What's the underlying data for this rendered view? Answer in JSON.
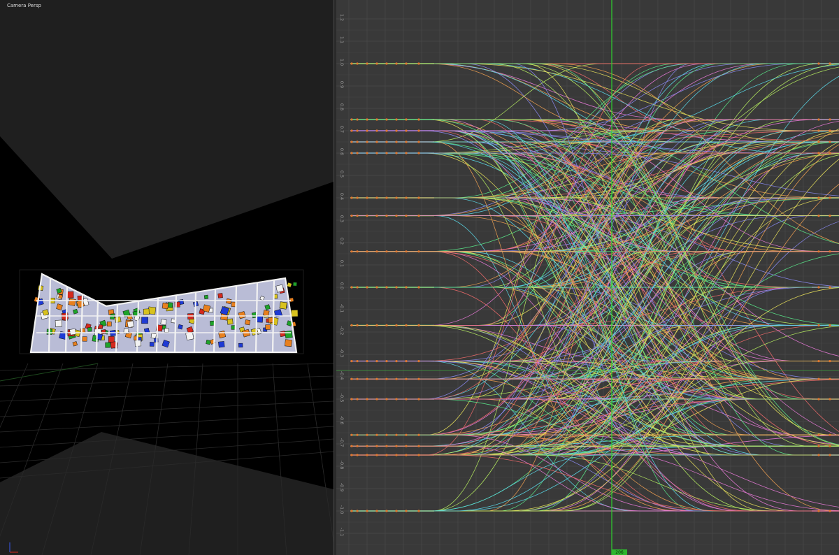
{
  "viewport": {
    "label": "Camera Persp",
    "colors": {
      "background": "#000000",
      "panel": "#1f1f1f",
      "shelf_frame": "#f2f2f2",
      "cube_red": "#d42a1e",
      "cube_green": "#1ea32a",
      "cube_blue": "#1e3ad4",
      "cube_yellow": "#d8c21e",
      "cube_orange": "#e8801e",
      "cube_white": "#f2f2f2"
    }
  },
  "graph_editor": {
    "y_ticks": [
      "1.2",
      "1.1",
      "1.0",
      "0.9",
      "0.8",
      "0.7",
      "0.6",
      "0.5",
      "0.4",
      "0.3",
      "0.2",
      "0.1",
      "0.0",
      "-0.1",
      "-0.2",
      "-0.3",
      "-0.4",
      "-0.5",
      "-0.6",
      "-0.7",
      "-0.8",
      "-0.9",
      "-1.0",
      "-1.1"
    ],
    "current_frame": "206",
    "curve_levels": [
      1.0,
      0.75,
      0.7,
      0.65,
      0.6,
      0.4,
      0.32,
      0.16,
      0.0,
      -0.17,
      -0.33,
      -0.41,
      -0.5,
      -0.66,
      -0.71,
      -0.75,
      -1.0
    ],
    "colors": {
      "background": "#393939",
      "grid": "#4a4a4a",
      "playhead": "#2fd22f",
      "keyframe": "#e07830",
      "curves": [
        "#e8e05a",
        "#5ae88a",
        "#8a8af0",
        "#e87ad8",
        "#5ad8e8",
        "#f0a050",
        "#b8f060",
        "#f06a6a"
      ]
    }
  }
}
